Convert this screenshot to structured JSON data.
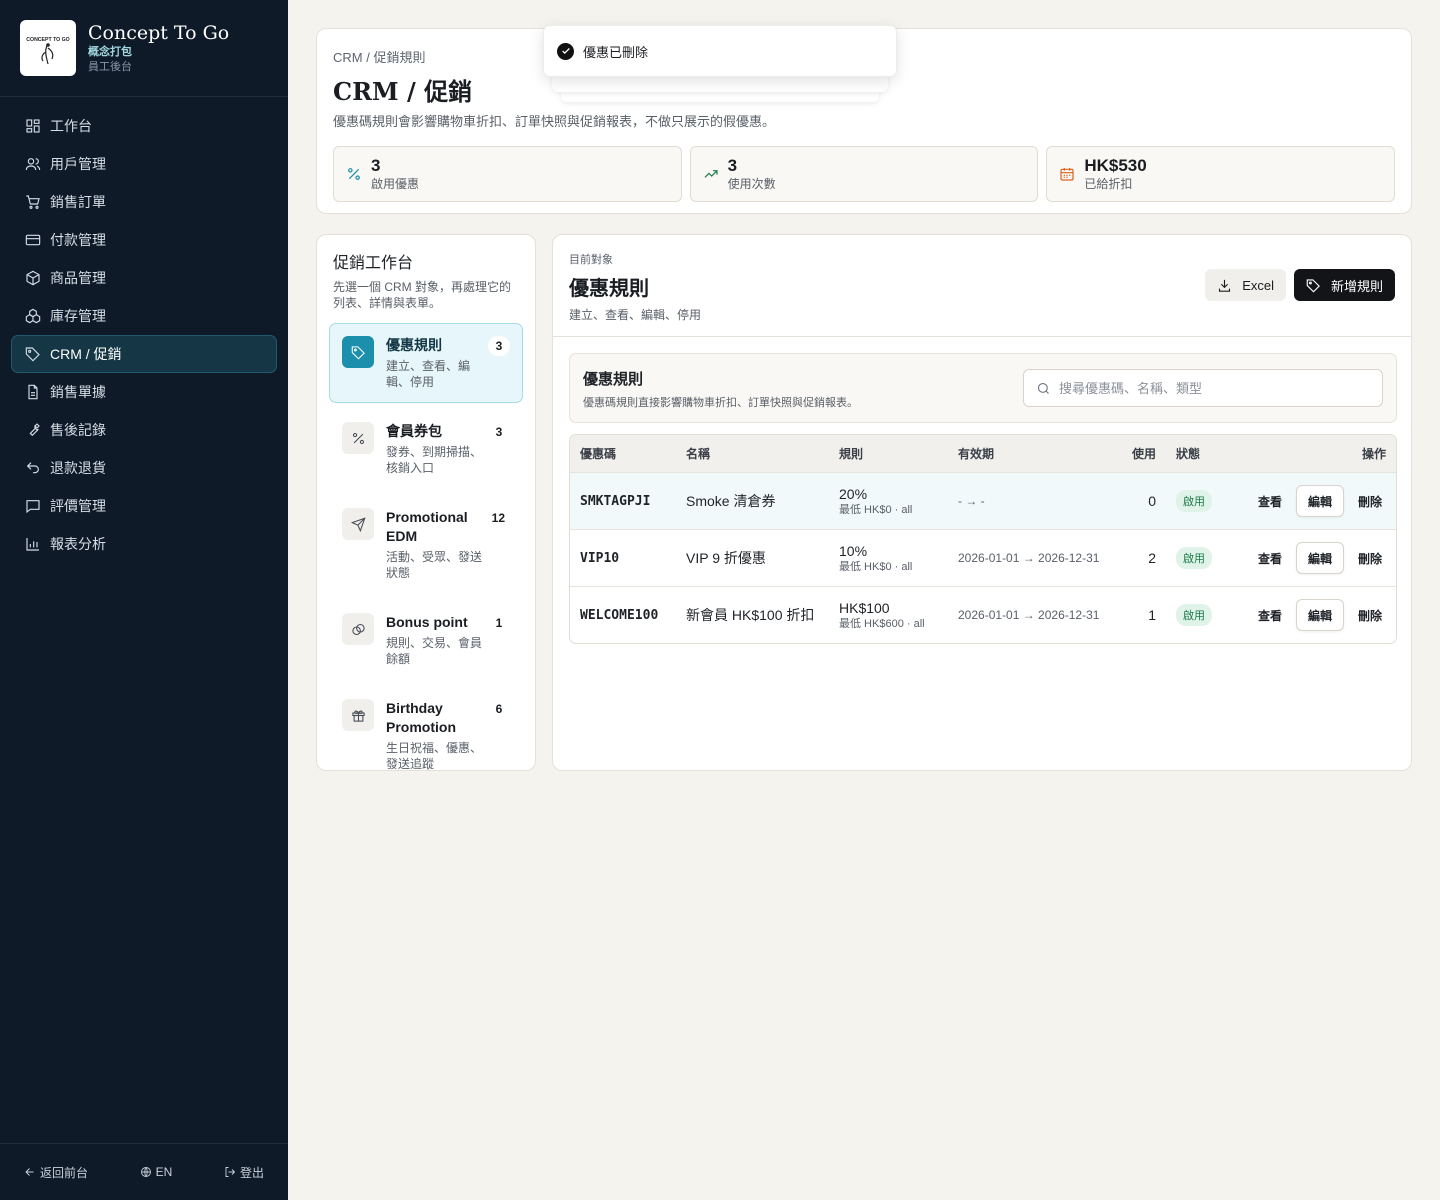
{
  "brand": {
    "name": "Concept To Go",
    "name_cn": "概念打包",
    "subtitle": "員工後台",
    "logo_text": "CONCEPT TO GO"
  },
  "nav": [
    {
      "label": "工作台",
      "icon": "dashboard-icon"
    },
    {
      "label": "用戶管理",
      "icon": "users-icon"
    },
    {
      "label": "銷售訂單",
      "icon": "cart-icon"
    },
    {
      "label": "付款管理",
      "icon": "credit-card-icon"
    },
    {
      "label": "商品管理",
      "icon": "box-icon"
    },
    {
      "label": "庫存管理",
      "icon": "boxes-icon"
    },
    {
      "label": "CRM / 促銷",
      "icon": "tag-icon",
      "active": true
    },
    {
      "label": "銷售單據",
      "icon": "file-icon"
    },
    {
      "label": "售後記錄",
      "icon": "wrench-icon"
    },
    {
      "label": "退款退貨",
      "icon": "undo-icon"
    },
    {
      "label": "評價管理",
      "icon": "message-icon"
    },
    {
      "label": "報表分析",
      "icon": "chart-icon"
    }
  ],
  "footer": {
    "back": "返回前台",
    "lang": "EN",
    "logout": "登出"
  },
  "header": {
    "breadcrumb": "CRM / 促銷規則",
    "title": "CRM / 促銷",
    "description": "優惠碼規則會影響購物車折扣、訂單快照與促銷報表，不做只展示的假優惠。",
    "stats": [
      {
        "value": "3",
        "label": "啟用優惠",
        "icon": "percent-icon",
        "color": "#1b8fab"
      },
      {
        "value": "3",
        "label": "使用次數",
        "icon": "trending-up-icon",
        "color": "#1e7b4b"
      },
      {
        "value": "HK$530",
        "label": "已給折扣",
        "icon": "calendar-icon",
        "color": "#d9621e"
      }
    ]
  },
  "toast": {
    "message": "優惠已刪除"
  },
  "workspace": {
    "title": "促銷工作台",
    "description": "先選一個 CRM 對象，再處理它的列表、詳情與表單。",
    "items": [
      {
        "name": "優惠規則",
        "sub": "建立、查看、編輯、停用",
        "count": "3",
        "icon": "tag-icon",
        "active": true
      },
      {
        "name": "會員券包",
        "sub": "發券、到期掃描、核銷入口",
        "count": "3",
        "icon": "percent-icon"
      },
      {
        "name": "Promotional EDM",
        "sub": "活動、受眾、發送狀態",
        "count": "12",
        "icon": "send-icon"
      },
      {
        "name": "Bonus point",
        "sub": "規則、交易、會員餘額",
        "count": "1",
        "icon": "coins-icon"
      },
      {
        "name": "Birthday Promotion",
        "sub": "生日祝福、優惠、發送追蹤",
        "count": "6",
        "icon": "gift-icon"
      }
    ]
  },
  "main": {
    "eyebrow": "目前對象",
    "title": "優惠規則",
    "subtitle": "建立、查看、編輯、停用",
    "excel_label": "Excel",
    "new_label": "新增規則",
    "rules_title": "優惠規則",
    "rules_desc": "優惠碼規則直接影響購物車折扣、訂單快照與促銷報表。",
    "search_placeholder": "搜尋優惠碼、名稱、類型",
    "columns": {
      "code": "優惠碼",
      "name": "名稱",
      "rule": "規則",
      "valid": "有效期",
      "usage": "使用",
      "status": "狀態",
      "ops": "操作"
    },
    "rows": [
      {
        "code": "SMKTAGPJI",
        "name": "Smoke 清倉券",
        "rule": "20%",
        "min": "最低 HK$0 · all",
        "valid": "- → -",
        "usage": "0",
        "status": "啟用",
        "view": "查看",
        "edit": "編輯",
        "delete": "刪除"
      },
      {
        "code": "VIP10",
        "name": "VIP 9 折優惠",
        "rule": "10%",
        "min": "最低 HK$0 · all",
        "valid": "2026-01-01 → 2026-12-31",
        "usage": "2",
        "status": "啟用",
        "view": "查看",
        "edit": "編輯",
        "delete": "刪除"
      },
      {
        "code": "WELCOME100",
        "name": "新會員 HK$100 折扣",
        "rule": "HK$100",
        "min": "最低 HK$600 · all",
        "valid": "2026-01-01 → 2026-12-31",
        "usage": "1",
        "status": "啟用",
        "view": "查看",
        "edit": "編輯",
        "delete": "刪除"
      }
    ]
  }
}
